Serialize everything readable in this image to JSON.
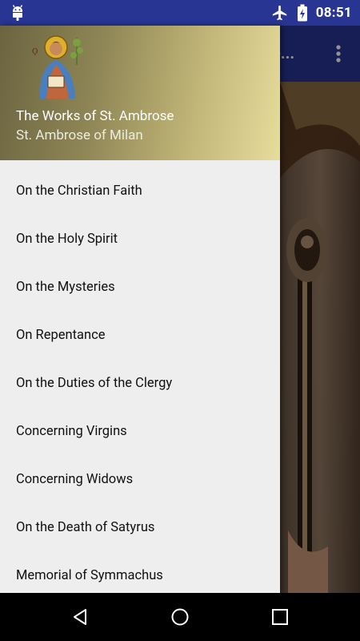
{
  "status_bar": {
    "time": "08:51",
    "icons": [
      "android-debug-icon",
      "airplane-mode-icon",
      "battery-charging-icon"
    ]
  },
  "app_bar": {
    "title_partial": "e...",
    "overflow_icon": "more-vert-icon",
    "color": "#283593"
  },
  "drawer": {
    "header": {
      "title": "The Works of St. Ambrose",
      "subtitle": "St. Ambrose of Milan",
      "avatar_icon": "saint-icon-image"
    },
    "items": [
      {
        "label": "On the Christian Faith"
      },
      {
        "label": "On the Holy Spirit"
      },
      {
        "label": "On the Mysteries"
      },
      {
        "label": "On Repentance"
      },
      {
        "label": "On the Duties of the Clergy"
      },
      {
        "label": "Concerning Virgins"
      },
      {
        "label": "Concerning Widows"
      },
      {
        "label": "On the Death of Satyrus"
      },
      {
        "label": "Memorial of Symmachus"
      }
    ]
  },
  "nav_bar": {
    "back": "back-icon",
    "home": "home-icon",
    "recents": "recents-icon"
  }
}
